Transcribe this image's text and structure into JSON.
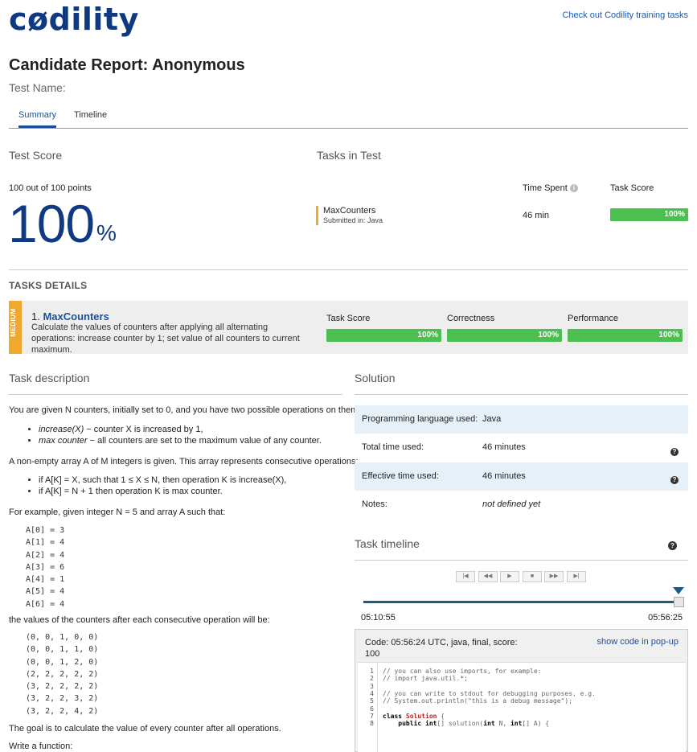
{
  "header": {
    "logo": "cødility",
    "training_link": "Check out Codility training tasks",
    "report_title": "Candidate Report: Anonymous",
    "test_name_label": "Test Name:"
  },
  "tabs": [
    {
      "label": "Summary",
      "active": true
    },
    {
      "label": "Timeline",
      "active": false
    }
  ],
  "summary": {
    "test_score_heading": "Test Score",
    "points": "100 out of 100 points",
    "score_value": "100",
    "score_unit": "%",
    "tasks_heading": "Tasks in Test",
    "col_time": "Time Spent",
    "col_score": "Task Score",
    "info_icon_glyph": "i",
    "task": {
      "name": "MaxCounters",
      "submitted": "Submitted in: Java",
      "time": "46 min",
      "score_label": "100%",
      "score_fraction": 1.0
    }
  },
  "details": {
    "heading": "TASKS DETAILS",
    "difficulty": "MEDIUM",
    "task_number": "1.",
    "task_name": "MaxCounters",
    "task_desc": "Calculate the values of counters after applying all alternating operations: increase counter by 1; set value of all counters to current maximum.",
    "metrics": [
      {
        "label": "Task Score",
        "value": "100%",
        "fraction": 1.0
      },
      {
        "label": "Correctness",
        "value": "100%",
        "fraction": 1.0
      },
      {
        "label": "Performance",
        "value": "100%",
        "fraction": 1.0
      }
    ]
  },
  "description": {
    "heading": "Task description",
    "p1": "You are given N counters, initially set to 0, and you have two possible operations on them:",
    "ops": [
      {
        "name": "increase(X)",
        "text": " − counter X is increased by 1,"
      },
      {
        "name": "max counter",
        "text": " − all counters are set to the maximum value of any counter."
      }
    ],
    "p2": "A non-empty array A of M integers is given. This array represents consecutive operations:",
    "rules": [
      "if A[K] = X, such that 1 ≤ X ≤ N, then operation K is increase(X),",
      "if A[K] = N + 1 then operation K is max counter."
    ],
    "p3": "For example, given integer N = 5 and array A such that:",
    "array_lines": [
      "A[0] = 3",
      "A[1] = 4",
      "A[2] = 4",
      "A[3] = 6",
      "A[4] = 1",
      "A[5] = 4",
      "A[6] = 4"
    ],
    "p4": "the values of the counters after each consecutive operation will be:",
    "counter_lines": [
      "(0, 0, 1, 0, 0)",
      "(0, 0, 1, 1, 0)",
      "(0, 0, 1, 2, 0)",
      "(2, 2, 2, 2, 2)",
      "(3, 2, 2, 2, 2)",
      "(3, 2, 2, 3, 2)",
      "(3, 2, 2, 4, 2)"
    ],
    "p5": "The goal is to calculate the value of every counter after all operations.",
    "p6": "Write a function:"
  },
  "solution": {
    "heading": "Solution",
    "help_glyph": "?",
    "rows": [
      {
        "label": "Programming language used:",
        "value": "Java",
        "help": false,
        "italic": false
      },
      {
        "label": "Total time used:",
        "value": "46 minutes",
        "help": true,
        "italic": false
      },
      {
        "label": "Effective time used:",
        "value": "46 minutes",
        "help": true,
        "italic": false
      },
      {
        "label": "Notes:",
        "value": "not defined yet",
        "help": false,
        "italic": true
      }
    ]
  },
  "timeline": {
    "heading": "Task timeline",
    "buttons": [
      {
        "name": "first-button",
        "glyph": "|◀"
      },
      {
        "name": "rewind-button",
        "glyph": "◀◀"
      },
      {
        "name": "play-button",
        "glyph": "▶"
      },
      {
        "name": "stop-button",
        "glyph": "■"
      },
      {
        "name": "forward-button",
        "glyph": "▶▶"
      },
      {
        "name": "last-button",
        "glyph": "▶|"
      }
    ],
    "start_time": "05:10:55",
    "end_time": "05:56:25",
    "position_fraction": 1.0
  },
  "code": {
    "header_line1": "Code: 05:56:24 UTC, java, final, score:",
    "header_line2": "100",
    "popup_link": "show code in pop-up",
    "lines": [
      {
        "n": "1",
        "t": "// you can also use imports, for example:"
      },
      {
        "n": "2",
        "t": "// import java.util.*;"
      },
      {
        "n": "3",
        "t": ""
      },
      {
        "n": "4",
        "t": "// you can write to stdout for debugging purposes, e.g."
      },
      {
        "n": "5",
        "t": "// System.out.println(\"this is a debug message\");"
      },
      {
        "n": "6",
        "t": ""
      },
      {
        "n": "7",
        "t": "class Solution {"
      },
      {
        "n": "8",
        "t": "    public int[] solution(int N, int[] A) {"
      }
    ]
  },
  "colors": {
    "brand": "#0f3a82",
    "link": "#1a4f9c",
    "success": "#4bbf50",
    "medium": "#f0a92e",
    "shade": "#e6f0f8"
  }
}
